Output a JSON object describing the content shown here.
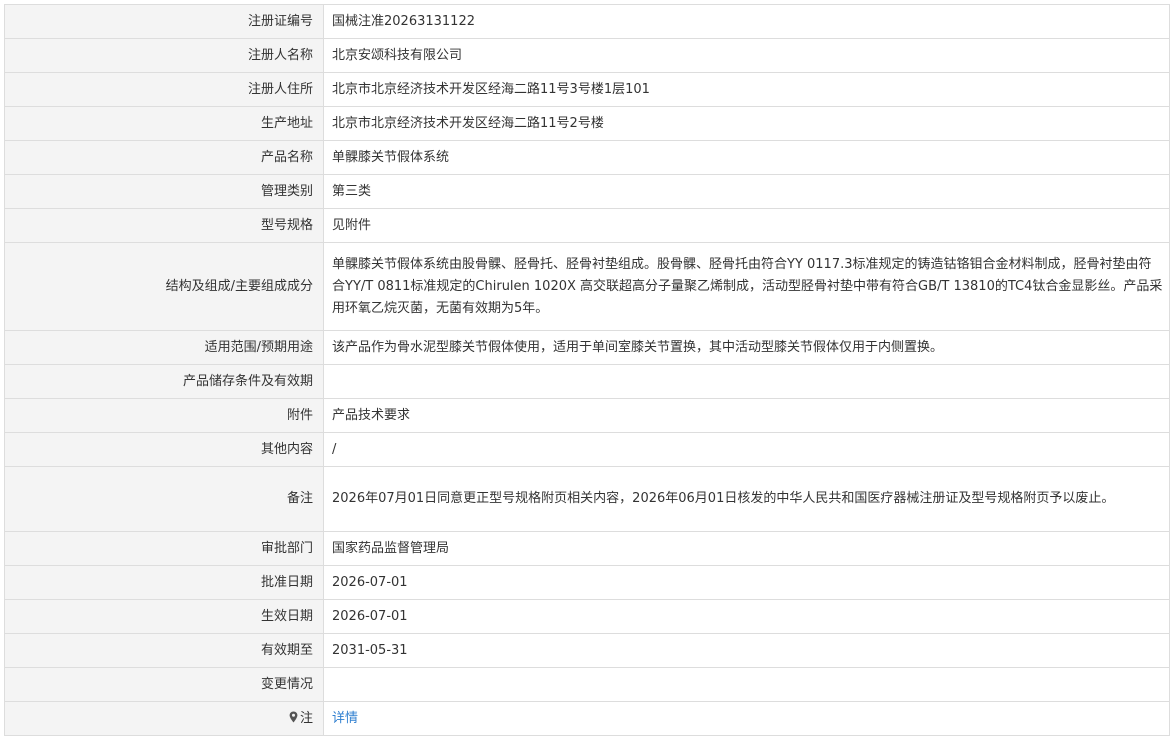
{
  "rows": [
    {
      "label": "注册证编号",
      "value": "国械注准20263131122"
    },
    {
      "label": "注册人名称",
      "value": "北京安颂科技有限公司"
    },
    {
      "label": "注册人住所",
      "value": "北京市北京经济技术开发区经海二路11号3号楼1层101"
    },
    {
      "label": "生产地址",
      "value": "北京市北京经济技术开发区经海二路11号2号楼"
    },
    {
      "label": "产品名称",
      "value": "单髁膝关节假体系统"
    },
    {
      "label": "管理类别",
      "value": "第三类"
    },
    {
      "label": "型号规格",
      "value": "见附件"
    },
    {
      "label": "结构及组成/主要组成成分",
      "value": "单髁膝关节假体系统由股骨髁、胫骨托、胫骨衬垫组成。股骨髁、胫骨托由符合YY 0117.3标准规定的铸造钴铬钼合金材料制成，胫骨衬垫由符合YY/T 0811标准规定的Chirulen 1020X 高交联超高分子量聚乙烯制成，活动型胫骨衬垫中带有符合GB/T 13810的TC4钛合金显影丝。产品采用环氧乙烷灭菌，无菌有效期为5年。"
    },
    {
      "label": "适用范围/预期用途",
      "value": "该产品作为骨水泥型膝关节假体使用，适用于单间室膝关节置换，其中活动型膝关节假体仅用于内侧置换。"
    },
    {
      "label": "产品储存条件及有效期",
      "value": ""
    },
    {
      "label": "附件",
      "value": "产品技术要求"
    },
    {
      "label": "其他内容",
      "value": "/"
    },
    {
      "label": "备注",
      "value": "2026年07月01日同意更正型号规格附页相关内容，2026年06月01日核发的中华人民共和国医疗器械注册证及型号规格附页予以废止。"
    },
    {
      "label": "审批部门",
      "value": "国家药品监督管理局"
    },
    {
      "label": "批准日期",
      "value": "2026-07-01"
    },
    {
      "label": "生效日期",
      "value": "2026-07-01"
    },
    {
      "label": "有效期至",
      "value": "2031-05-31"
    },
    {
      "label": "变更情况",
      "value": ""
    }
  ],
  "note_row": {
    "label": "注",
    "icon": "pin-icon",
    "link_text": "详情"
  },
  "colors": {
    "label_bg": "#f4f4f4",
    "border": "#dddddd",
    "link": "#2f7fd0",
    "text": "#333333"
  }
}
